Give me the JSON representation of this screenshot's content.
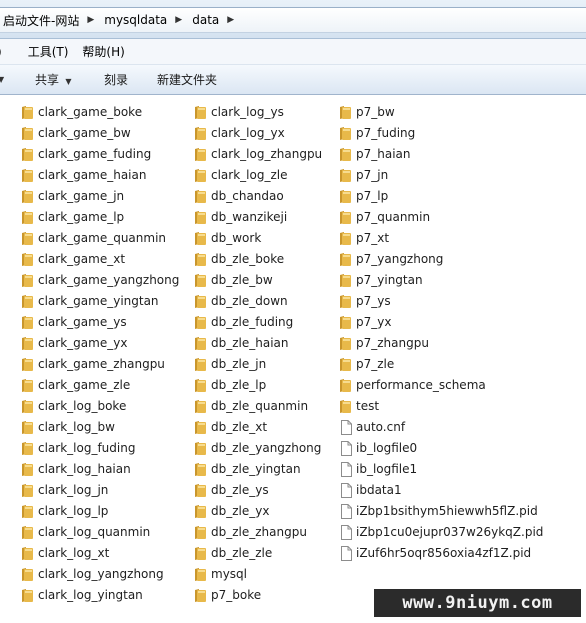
{
  "address": {
    "crumbs": [
      "启动文件-网站",
      "mysqldata",
      "data"
    ],
    "separator": "▶"
  },
  "menu": {
    "items": [
      "工具(T)",
      "帮助(H)"
    ]
  },
  "toolbar": {
    "share_label": "共享",
    "burn_label": "刻录",
    "new_folder_label": "新建文件夹"
  },
  "files": {
    "col1": [
      "clark_game_boke",
      "clark_game_bw",
      "clark_game_fuding",
      "clark_game_haian",
      "clark_game_jn",
      "clark_game_lp",
      "clark_game_quanmin",
      "clark_game_xt",
      "clark_game_yangzhong",
      "clark_game_yingtan",
      "clark_game_ys",
      "clark_game_yx",
      "clark_game_zhangpu",
      "clark_game_zle",
      "clark_log_boke",
      "clark_log_bw",
      "clark_log_fuding",
      "clark_log_haian",
      "clark_log_jn",
      "clark_log_lp",
      "clark_log_quanmin",
      "clark_log_xt",
      "clark_log_yangzhong",
      "clark_log_yingtan"
    ],
    "col2": [
      "clark_log_ys",
      "clark_log_yx",
      "clark_log_zhangpu",
      "clark_log_zle",
      "db_chandao",
      "db_wanzikeji",
      "db_work",
      "db_zle_boke",
      "db_zle_bw",
      "db_zle_down",
      "db_zle_fuding",
      "db_zle_haian",
      "db_zle_jn",
      "db_zle_lp",
      "db_zle_quanmin",
      "db_zle_xt",
      "db_zle_yangzhong",
      "db_zle_yingtan",
      "db_zle_ys",
      "db_zle_yx",
      "db_zle_zhangpu",
      "db_zle_zle",
      "mysql",
      "p7_boke"
    ],
    "col3_folders": [
      "p7_bw",
      "p7_fuding",
      "p7_haian",
      "p7_jn",
      "p7_lp",
      "p7_quanmin",
      "p7_xt",
      "p7_yangzhong",
      "p7_yingtan",
      "p7_ys",
      "p7_yx",
      "p7_zhangpu",
      "p7_zle",
      "performance_schema",
      "test"
    ],
    "col3_files": [
      "auto.cnf",
      "ib_logfile0",
      "ib_logfile1",
      "ibdata1",
      "iZbp1bsithym5hiewwh5flZ.pid",
      "iZbp1cu0ejupr037w26ykqZ.pid",
      "iZuf6hr5oqr856oxia4zf1Z.pid"
    ]
  },
  "watermark": "www.9niuym.com",
  "colors": {
    "folder": "#e8b94a",
    "folder_dark": "#c9962c",
    "toolbar_top": "#f5f9fd",
    "toolbar_bottom": "#dbe6f3"
  }
}
